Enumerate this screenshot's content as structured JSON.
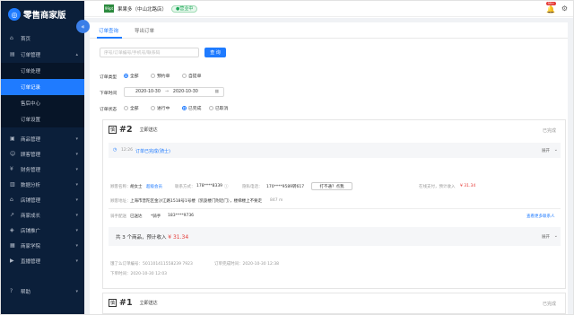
{
  "sidebar": {
    "logo_text": "零售商家版",
    "items": [
      {
        "label": "首页",
        "icon": "home-icon"
      },
      {
        "label": "订单管理",
        "icon": "order-icon",
        "arrow": "▴"
      },
      {
        "label": "商品管理",
        "icon": "goods-icon",
        "arrow": "▾"
      },
      {
        "label": "顾客管理",
        "icon": "customer-icon",
        "arrow": "▾"
      },
      {
        "label": "财务管理",
        "icon": "finance-icon",
        "arrow": "▾"
      },
      {
        "label": "数据分析",
        "icon": "analytics-icon",
        "arrow": "▾"
      },
      {
        "label": "店铺管理",
        "icon": "store-icon",
        "arrow": "▾"
      },
      {
        "label": "商家成长",
        "icon": "growth-icon",
        "arrow": "▾"
      },
      {
        "label": "店铺推广",
        "icon": "promo-icon",
        "arrow": "▾"
      },
      {
        "label": "商家学院",
        "icon": "school-icon",
        "arrow": "▾"
      },
      {
        "label": "直播管理",
        "icon": "live-icon",
        "arrow": "▾"
      },
      {
        "label": "帮助",
        "icon": "help-icon",
        "arrow": "▾"
      }
    ],
    "sub_items": [
      "订单处理",
      "订单记录",
      "售后中心",
      "订单设置"
    ]
  },
  "topbar": {
    "avatar_text": "99pt",
    "store_name": "果果多（中山北路店）",
    "status": "营业中",
    "badge": "99+"
  },
  "tabs": [
    "订单查询",
    "导出订单"
  ],
  "search": {
    "placeholder": "序号/订单编号/手机号/联系码",
    "button": "查 询"
  },
  "filters": {
    "type_label": "订单类型",
    "type_options": [
      "全部",
      "预约单",
      "自提单"
    ],
    "time_label": "下单时间",
    "date_from": "2020-10-30",
    "date_sep": "→",
    "date_to": "2020-10-30",
    "status_label": "订单状态",
    "status_options": [
      "全部",
      "进行中",
      "已完成",
      "已取消"
    ]
  },
  "order1": {
    "qing": "慎",
    "number": "#2",
    "mode": "立即送达",
    "status": "已完成",
    "time": "12:26",
    "done_text": "订单已完成(骑士)",
    "expand": "展开",
    "customer_label": "顾客名称：",
    "customer_name": "胡女士",
    "vip": "超级会员",
    "contact_label": "联系方式：",
    "contact": "178****8339",
    "privacy_label": "隐私电话：",
    "privacy": "170****9589转617",
    "no_call": "打不通？点我",
    "pay_label": "在线支付，预计收入",
    "income": "¥ 31.34",
    "addr_label": "顾客地址：",
    "address": "上海市普陀区金沙江路1518号1号楼（凯旋楼门附近门），楼梯楼上不要走",
    "distance": "847 m",
    "rider_label": "骑手配送",
    "rider_status": "已送达",
    "rider_name": "*骑手",
    "rider_phone": "183****9736",
    "more_contacts": "查看更多联系人",
    "note": "备注：请选新鲜整果或有绿大果谢",
    "total_prefix": "共 3 个商品，预计收入",
    "total_amount": "¥ 31.34",
    "order_no": "饿了么订单编号：501101411558239 7923",
    "complete_time": "订单完成时间：2020-10-30 12:38",
    "order_time": "下单时间：2020-10-30 12:03"
  },
  "order2": {
    "qing": "慎",
    "number": "#1",
    "mode": "立即送达",
    "status": "已完成"
  }
}
